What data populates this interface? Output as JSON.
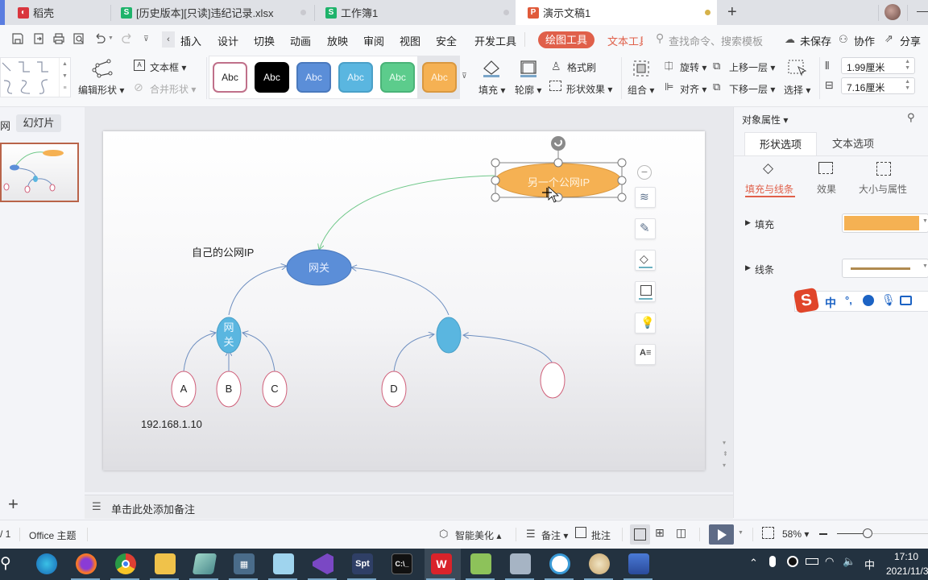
{
  "tabs": [
    {
      "label": "稻壳",
      "icon": "daoke-icon",
      "color": "#d9363e",
      "active": false
    },
    {
      "label": "[历史版本][只读]违纪记录.xlsx",
      "icon": "spreadsheet-icon",
      "color": "#1fb36b",
      "active": false
    },
    {
      "label": "工作簿1",
      "icon": "spreadsheet-icon",
      "color": "#1fb36b",
      "active": false
    },
    {
      "label": "演示文稿1",
      "icon": "presentation-icon",
      "color": "#e05a3a",
      "active": true
    }
  ],
  "new_tab": "+",
  "quick_access": {
    "save": "save-icon",
    "export": "export-icon",
    "print": "print-icon",
    "preview": "print-preview-icon",
    "undo": "undo-icon",
    "redo": "redo-icon",
    "more": "more-icon"
  },
  "menu": {
    "items": [
      "插入",
      "设计",
      "切换",
      "动画",
      "放映",
      "审阅",
      "视图",
      "安全",
      "开发工具"
    ],
    "drawing_tools": "绘图工具",
    "text_tools": "文本工具",
    "search_placeholder": "查找命令、搜索模板",
    "unsaved": "未保存",
    "collaborate": "协作",
    "share": "分享"
  },
  "ribbon": {
    "edit_shape": "编辑形状",
    "text_box": "文本框",
    "merge_shape": "合并形状",
    "style_presets": [
      {
        "label": "Abc",
        "bg": "#ffffff",
        "border": "#c0708a",
        "color": "#222"
      },
      {
        "label": "Abc",
        "bg": "#000000",
        "border": "#000000",
        "color": "#fff"
      },
      {
        "label": "Abc",
        "bg": "#5b8ed8",
        "border": "#4a79bd",
        "color": "#e8f0ff"
      },
      {
        "label": "Abc",
        "bg": "#5ab6e0",
        "border": "#4aa0c8",
        "color": "#e8f6ff"
      },
      {
        "label": "Abc",
        "bg": "#5ccc8c",
        "border": "#4ab378",
        "color": "#e8fff0"
      },
      {
        "label": "Abc",
        "bg": "#f5b153",
        "border": "#d99840",
        "color": "#fff3e0"
      }
    ],
    "fill": "填充",
    "outline": "轮廓",
    "format_painter": "格式刷",
    "shape_effects": "形状效果",
    "group": "组合",
    "rotate": "旋转",
    "align": "对齐",
    "bring_forward": "上移一层",
    "send_backward": "下移一层",
    "select": "选择",
    "height_value": "1.99厘米",
    "width_value": "7.16厘米"
  },
  "left_pane": {
    "outline_tab": "网",
    "slides_tab": "幻灯片",
    "add_slide": "+"
  },
  "slide": {
    "own_ip_label": "自己的公网IP",
    "lan_ip_label": "192.168.1.10",
    "nodes": {
      "gateway_main": "网关",
      "gateway_left": "网\n关",
      "remote_ip": "另一个公网IP",
      "a": "A",
      "b": "B",
      "c": "C",
      "d": "D",
      "e": ""
    },
    "colors": {
      "gateway_main": "#5b8ed8",
      "gateway_sub": "#5ab6e0",
      "remote": "#f5b153",
      "leaf_border": "#d0607a",
      "edge": "#6e8fc0",
      "edge_green": "#70c88a"
    }
  },
  "float_toolbar": [
    "collapse-icon",
    "layers-icon",
    "brush-icon",
    "fill-icon",
    "outline-icon",
    "bulb-icon",
    "text-select-icon"
  ],
  "notes_placeholder": "单击此处添加备注",
  "right_panel": {
    "title": "对象属性",
    "tabs": [
      "形状选项",
      "文本选项"
    ],
    "subtabs": [
      "填充与线条",
      "效果",
      "大小与属性"
    ],
    "fill_label": "填充",
    "line_label": "线条",
    "fill_color": "#f5b153",
    "line_color": "#b08a50"
  },
  "ime": {
    "chinese": "中",
    "punct": "°,"
  },
  "status": {
    "page": "/ 1",
    "theme": "Office 主题",
    "smart": "智能美化",
    "notes": "备注",
    "comments": "批注",
    "zoom": "58%",
    "zoom_fraction": 0.5
  },
  "taskbar": {
    "apps": [
      "search-icon",
      "edge-icon",
      "firefox-icon",
      "chrome-icon",
      "folder-icon",
      "notepad-icon",
      "calculator-icon",
      "anime-app-icon",
      "visual-studio-icon",
      "Spt",
      "terminal-icon",
      "wps-icon",
      "notepadpp-icon",
      "monitor-icon",
      "panda-icon",
      "paint-icon",
      "remote-icon"
    ],
    "tray_ime": "中",
    "time": "17:10",
    "date": "2021/11/3"
  }
}
